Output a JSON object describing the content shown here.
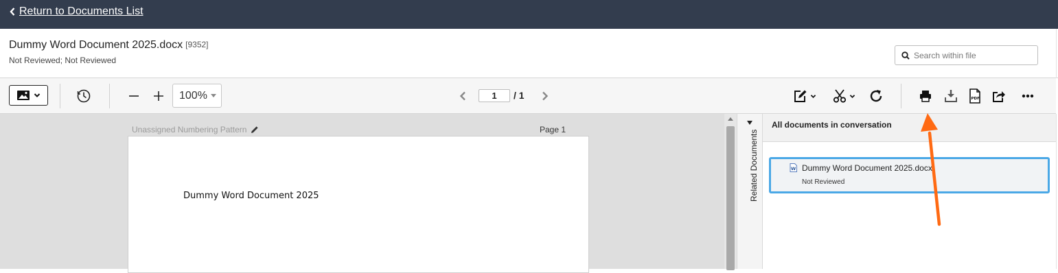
{
  "topbar": {
    "back_label": "Return to Documents List"
  },
  "header": {
    "title": "Dummy Word Document 2025.docx",
    "doc_id": "[9352]",
    "status": "Not Reviewed; Not Reviewed",
    "search_placeholder": "Search within file"
  },
  "toolbar": {
    "zoom": "100%",
    "page_current": "1",
    "page_total": "/ 1"
  },
  "viewer": {
    "numbering_pattern": "Unassigned Numbering Pattern",
    "page_label": "Page 1",
    "page_text": "Dummy Word Document 2025"
  },
  "related_tab": {
    "label": "Related Documents"
  },
  "panel": {
    "header": "All documents in conversation",
    "documents": [
      {
        "name": "Dummy Word Document 2025.docx",
        "status": "Not Reviewed"
      }
    ]
  },
  "colors": {
    "topbar_bg": "#333d4e",
    "selected_border": "#4aa8e6",
    "annotation_arrow": "#ff6a13"
  }
}
